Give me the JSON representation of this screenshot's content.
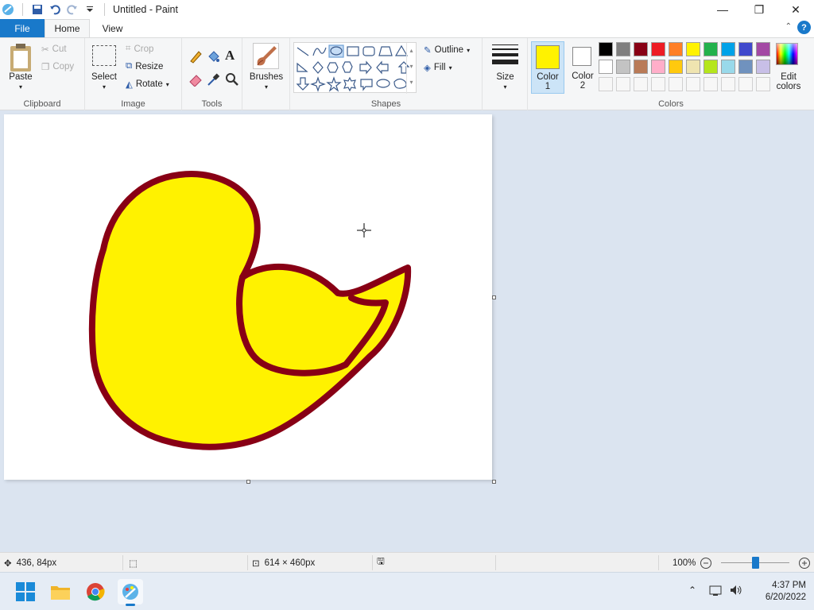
{
  "window": {
    "title": "Untitled - Paint"
  },
  "tabs": {
    "file": "File",
    "home": "Home",
    "view": "View"
  },
  "clipboard": {
    "paste": "Paste",
    "cut": "Cut",
    "copy": "Copy",
    "label": "Clipboard"
  },
  "image": {
    "select": "Select",
    "crop": "Crop",
    "resize": "Resize",
    "rotate": "Rotate",
    "label": "Image"
  },
  "tools": {
    "label": "Tools"
  },
  "brushes": {
    "label": "Brushes"
  },
  "shapes": {
    "outline": "Outline",
    "fill": "Fill",
    "label": "Shapes"
  },
  "size": {
    "label": "Size"
  },
  "colors": {
    "color1_label": "Color\n1",
    "color1_line1": "Color",
    "color1_line2": "1",
    "color2_line1": "Color",
    "color2_line2": "2",
    "edit_line1": "Edit",
    "edit_line2": "colors",
    "label": "Colors",
    "color1": "#fff200",
    "color2": "#ffffff",
    "palette_row1": [
      "#000000",
      "#7f7f7f",
      "#880015",
      "#ed1c24",
      "#ff7f27",
      "#fff200",
      "#22b14c",
      "#00a2e8",
      "#3f48cc",
      "#a349a4"
    ],
    "palette_row2": [
      "#ffffff",
      "#c3c3c3",
      "#b97a57",
      "#ffaec9",
      "#ffc90e",
      "#efe4b0",
      "#b5e61d",
      "#99d9ea",
      "#7092be",
      "#c8bfe7"
    ]
  },
  "drawing": {
    "fill": "#fff200",
    "stroke": "#880015"
  },
  "status": {
    "cursor_pos": "436, 84px",
    "canvas_size": "614 × 460px",
    "zoom": "100%"
  },
  "taskbar": {
    "time": "4:37 PM",
    "date": "6/20/2022"
  }
}
